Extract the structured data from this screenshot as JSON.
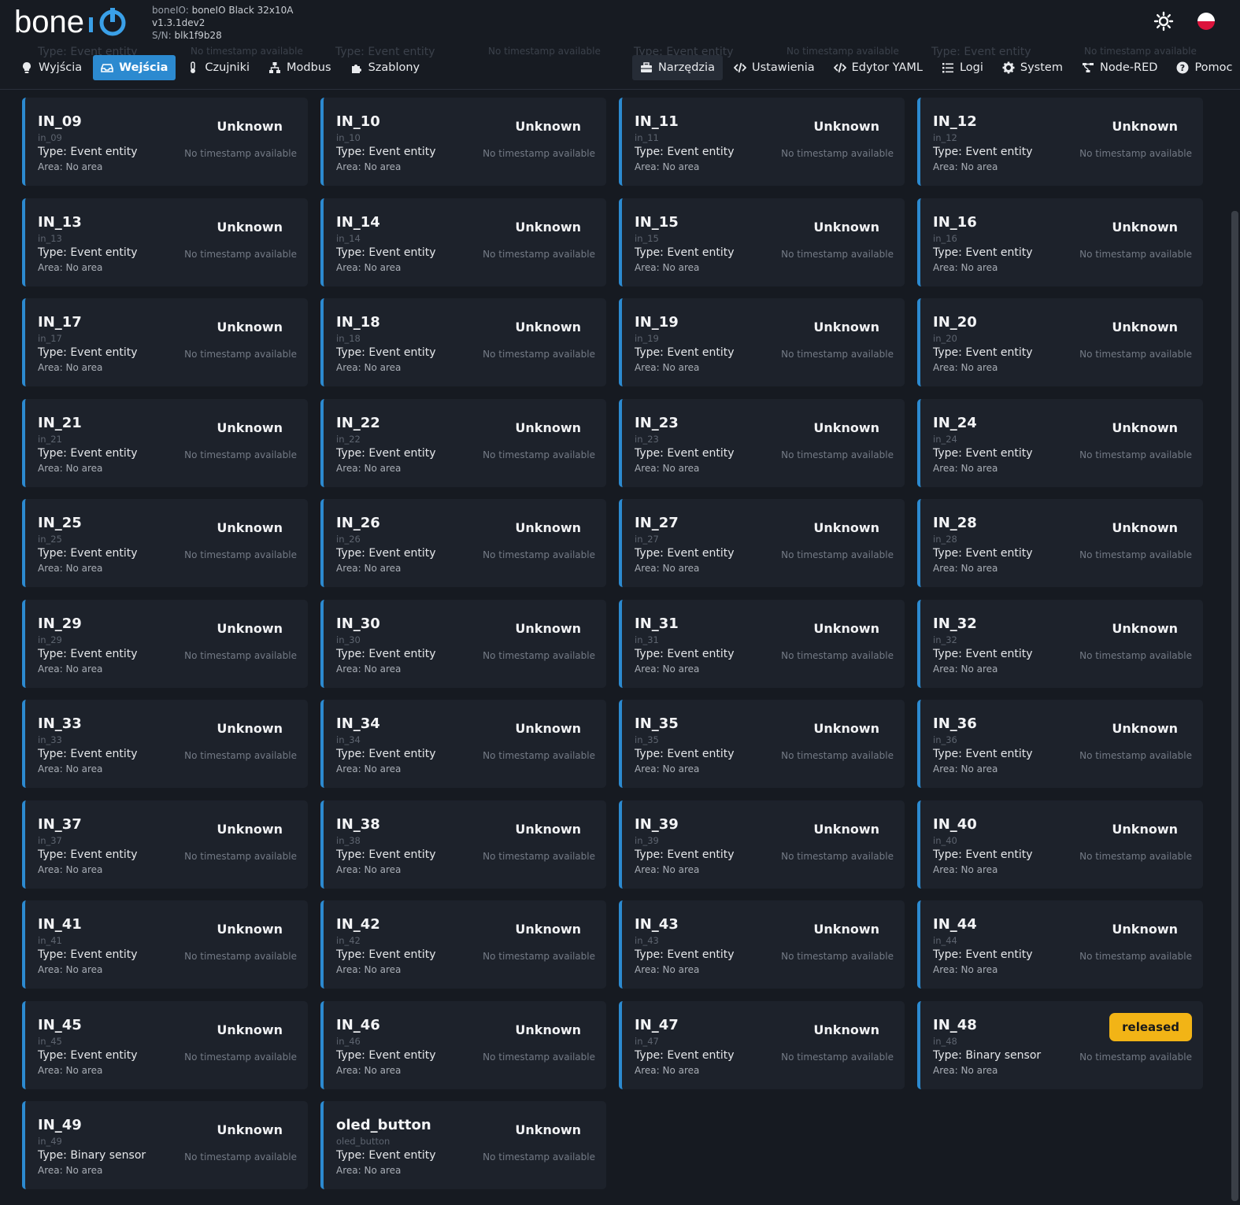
{
  "header": {
    "device_label": "boneIO:",
    "device_name": "boneIO Black 32x10A",
    "version": "v1.3.1dev2",
    "sn_label": "S/N:",
    "serial": "blk1f9b28"
  },
  "ghost_row": {
    "type_text": "Type: Event entity",
    "ts_text": "No timestamp available"
  },
  "nav_left": [
    {
      "label": "Wyjścia",
      "icon": "bulb-icon",
      "active": false
    },
    {
      "label": "Wejścia",
      "icon": "inputs-icon",
      "active": true
    },
    {
      "label": "Czujniki",
      "icon": "thermometer-icon",
      "active": false
    },
    {
      "label": "Modbus",
      "icon": "network-icon",
      "active": false
    },
    {
      "label": "Szablony",
      "icon": "puzzle-icon",
      "active": false
    }
  ],
  "nav_right": [
    {
      "label": "Narzędzia",
      "icon": "toolbox-icon"
    },
    {
      "label": "Ustawienia",
      "icon": "code-icon"
    },
    {
      "label": "Edytor YAML",
      "icon": "code-icon"
    },
    {
      "label": "Logi",
      "icon": "list-icon"
    },
    {
      "label": "System",
      "icon": "gear-icon"
    },
    {
      "label": "Node-RED",
      "icon": "nodes-icon"
    },
    {
      "label": "Pomoc",
      "icon": "help-icon"
    }
  ],
  "cards": [
    {
      "name": "IN_09",
      "id": "in_09",
      "type": "Type: Event entity",
      "area": "Area: No area",
      "state": "Unknown",
      "ts": "No timestamp available"
    },
    {
      "name": "IN_10",
      "id": "in_10",
      "type": "Type: Event entity",
      "area": "Area: No area",
      "state": "Unknown",
      "ts": "No timestamp available"
    },
    {
      "name": "IN_11",
      "id": "in_11",
      "type": "Type: Event entity",
      "area": "Area: No area",
      "state": "Unknown",
      "ts": "No timestamp available"
    },
    {
      "name": "IN_12",
      "id": "in_12",
      "type": "Type: Event entity",
      "area": "Area: No area",
      "state": "Unknown",
      "ts": "No timestamp available"
    },
    {
      "name": "IN_13",
      "id": "in_13",
      "type": "Type: Event entity",
      "area": "Area: No area",
      "state": "Unknown",
      "ts": "No timestamp available"
    },
    {
      "name": "IN_14",
      "id": "in_14",
      "type": "Type: Event entity",
      "area": "Area: No area",
      "state": "Unknown",
      "ts": "No timestamp available"
    },
    {
      "name": "IN_15",
      "id": "in_15",
      "type": "Type: Event entity",
      "area": "Area: No area",
      "state": "Unknown",
      "ts": "No timestamp available"
    },
    {
      "name": "IN_16",
      "id": "in_16",
      "type": "Type: Event entity",
      "area": "Area: No area",
      "state": "Unknown",
      "ts": "No timestamp available"
    },
    {
      "name": "IN_17",
      "id": "in_17",
      "type": "Type: Event entity",
      "area": "Area: No area",
      "state": "Unknown",
      "ts": "No timestamp available"
    },
    {
      "name": "IN_18",
      "id": "in_18",
      "type": "Type: Event entity",
      "area": "Area: No area",
      "state": "Unknown",
      "ts": "No timestamp available"
    },
    {
      "name": "IN_19",
      "id": "in_19",
      "type": "Type: Event entity",
      "area": "Area: No area",
      "state": "Unknown",
      "ts": "No timestamp available"
    },
    {
      "name": "IN_20",
      "id": "in_20",
      "type": "Type: Event entity",
      "area": "Area: No area",
      "state": "Unknown",
      "ts": "No timestamp available"
    },
    {
      "name": "IN_21",
      "id": "in_21",
      "type": "Type: Event entity",
      "area": "Area: No area",
      "state": "Unknown",
      "ts": "No timestamp available"
    },
    {
      "name": "IN_22",
      "id": "in_22",
      "type": "Type: Event entity",
      "area": "Area: No area",
      "state": "Unknown",
      "ts": "No timestamp available"
    },
    {
      "name": "IN_23",
      "id": "in_23",
      "type": "Type: Event entity",
      "area": "Area: No area",
      "state": "Unknown",
      "ts": "No timestamp available"
    },
    {
      "name": "IN_24",
      "id": "in_24",
      "type": "Type: Event entity",
      "area": "Area: No area",
      "state": "Unknown",
      "ts": "No timestamp available"
    },
    {
      "name": "IN_25",
      "id": "in_25",
      "type": "Type: Event entity",
      "area": "Area: No area",
      "state": "Unknown",
      "ts": "No timestamp available"
    },
    {
      "name": "IN_26",
      "id": "in_26",
      "type": "Type: Event entity",
      "area": "Area: No area",
      "state": "Unknown",
      "ts": "No timestamp available"
    },
    {
      "name": "IN_27",
      "id": "in_27",
      "type": "Type: Event entity",
      "area": "Area: No area",
      "state": "Unknown",
      "ts": "No timestamp available"
    },
    {
      "name": "IN_28",
      "id": "in_28",
      "type": "Type: Event entity",
      "area": "Area: No area",
      "state": "Unknown",
      "ts": "No timestamp available"
    },
    {
      "name": "IN_29",
      "id": "in_29",
      "type": "Type: Event entity",
      "area": "Area: No area",
      "state": "Unknown",
      "ts": "No timestamp available"
    },
    {
      "name": "IN_30",
      "id": "in_30",
      "type": "Type: Event entity",
      "area": "Area: No area",
      "state": "Unknown",
      "ts": "No timestamp available"
    },
    {
      "name": "IN_31",
      "id": "in_31",
      "type": "Type: Event entity",
      "area": "Area: No area",
      "state": "Unknown",
      "ts": "No timestamp available"
    },
    {
      "name": "IN_32",
      "id": "in_32",
      "type": "Type: Event entity",
      "area": "Area: No area",
      "state": "Unknown",
      "ts": "No timestamp available"
    },
    {
      "name": "IN_33",
      "id": "in_33",
      "type": "Type: Event entity",
      "area": "Area: No area",
      "state": "Unknown",
      "ts": "No timestamp available"
    },
    {
      "name": "IN_34",
      "id": "in_34",
      "type": "Type: Event entity",
      "area": "Area: No area",
      "state": "Unknown",
      "ts": "No timestamp available"
    },
    {
      "name": "IN_35",
      "id": "in_35",
      "type": "Type: Event entity",
      "area": "Area: No area",
      "state": "Unknown",
      "ts": "No timestamp available"
    },
    {
      "name": "IN_36",
      "id": "in_36",
      "type": "Type: Event entity",
      "area": "Area: No area",
      "state": "Unknown",
      "ts": "No timestamp available"
    },
    {
      "name": "IN_37",
      "id": "in_37",
      "type": "Type: Event entity",
      "area": "Area: No area",
      "state": "Unknown",
      "ts": "No timestamp available"
    },
    {
      "name": "IN_38",
      "id": "in_38",
      "type": "Type: Event entity",
      "area": "Area: No area",
      "state": "Unknown",
      "ts": "No timestamp available"
    },
    {
      "name": "IN_39",
      "id": "in_39",
      "type": "Type: Event entity",
      "area": "Area: No area",
      "state": "Unknown",
      "ts": "No timestamp available"
    },
    {
      "name": "IN_40",
      "id": "in_40",
      "type": "Type: Event entity",
      "area": "Area: No area",
      "state": "Unknown",
      "ts": "No timestamp available"
    },
    {
      "name": "IN_41",
      "id": "in_41",
      "type": "Type: Event entity",
      "area": "Area: No area",
      "state": "Unknown",
      "ts": "No timestamp available"
    },
    {
      "name": "IN_42",
      "id": "in_42",
      "type": "Type: Event entity",
      "area": "Area: No area",
      "state": "Unknown",
      "ts": "No timestamp available"
    },
    {
      "name": "IN_43",
      "id": "in_43",
      "type": "Type: Event entity",
      "area": "Area: No area",
      "state": "Unknown",
      "ts": "No timestamp available"
    },
    {
      "name": "IN_44",
      "id": "in_44",
      "type": "Type: Event entity",
      "area": "Area: No area",
      "state": "Unknown",
      "ts": "No timestamp available"
    },
    {
      "name": "IN_45",
      "id": "in_45",
      "type": "Type: Event entity",
      "area": "Area: No area",
      "state": "Unknown",
      "ts": "No timestamp available"
    },
    {
      "name": "IN_46",
      "id": "in_46",
      "type": "Type: Event entity",
      "area": "Area: No area",
      "state": "Unknown",
      "ts": "No timestamp available"
    },
    {
      "name": "IN_47",
      "id": "in_47",
      "type": "Type: Event entity",
      "area": "Area: No area",
      "state": "Unknown",
      "ts": "No timestamp available"
    },
    {
      "name": "IN_48",
      "id": "in_48",
      "type": "Type: Binary sensor",
      "area": "Area: No area",
      "state": "released",
      "ts": "No timestamp available",
      "badge": true
    },
    {
      "name": "IN_49",
      "id": "in_49",
      "type": "Type: Binary sensor",
      "area": "Area: No area",
      "state": "Unknown",
      "ts": "No timestamp available"
    },
    {
      "name": "oled_button",
      "id": "oled_button",
      "type": "Type: Event entity",
      "area": "Area: No area",
      "state": "Unknown",
      "ts": "No timestamp available"
    }
  ],
  "colors": {
    "accent": "#2c8ad0",
    "badge": "#f2b416",
    "background": "#161a21",
    "card": "#1d222b"
  }
}
